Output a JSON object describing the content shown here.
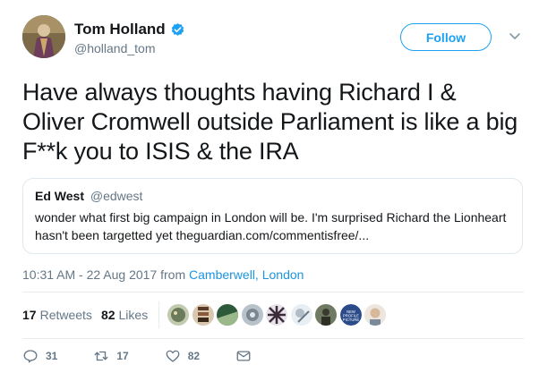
{
  "author": {
    "name": "Tom Holland",
    "handle": "@holland_tom"
  },
  "follow_label": "Follow",
  "tweet_text": "Have always thoughts having Richard I & Oliver Cromwell outside Parliament is like a big F**k you to ISIS & the IRA",
  "quoted": {
    "name": "Ed West",
    "handle": "@edwest",
    "text": "wonder what first big campaign in London will be. I'm surprised Richard the Lionheart hasn't been targetted yet theguardian.com/commentisfree/..."
  },
  "meta": {
    "time": "10:31 AM - 22 Aug 2017 from ",
    "location": "Camberwell, London"
  },
  "stats": {
    "retweets_count": "17",
    "retweets_label": "Retweets",
    "likes_count": "82",
    "likes_label": "Likes"
  },
  "likers": [
    {
      "icon": "liker-avatar-1",
      "color": "#8a9a7a"
    },
    {
      "icon": "liker-avatar-2",
      "color": "#5a4a3a"
    },
    {
      "icon": "liker-avatar-3",
      "color": "#3d6b4a"
    },
    {
      "icon": "liker-avatar-4",
      "color": "#9aa4ae"
    },
    {
      "icon": "liker-avatar-5",
      "color": "#4a3a4a"
    },
    {
      "icon": "liker-avatar-6",
      "color": "#c9d4dc"
    },
    {
      "icon": "liker-avatar-7",
      "color": "#4f5a44"
    },
    {
      "icon": "liker-avatar-8",
      "color": "#2a4a8a"
    },
    {
      "icon": "liker-avatar-9",
      "color": "#d8b89a"
    }
  ],
  "liker_badge_text": "NEW PROFILE PICTURE",
  "actions": {
    "replies": "31",
    "retweets": "17",
    "likes": "82"
  },
  "colors": {
    "accent": "#1da1f2",
    "text": "#14171a",
    "muted": "#657786"
  }
}
